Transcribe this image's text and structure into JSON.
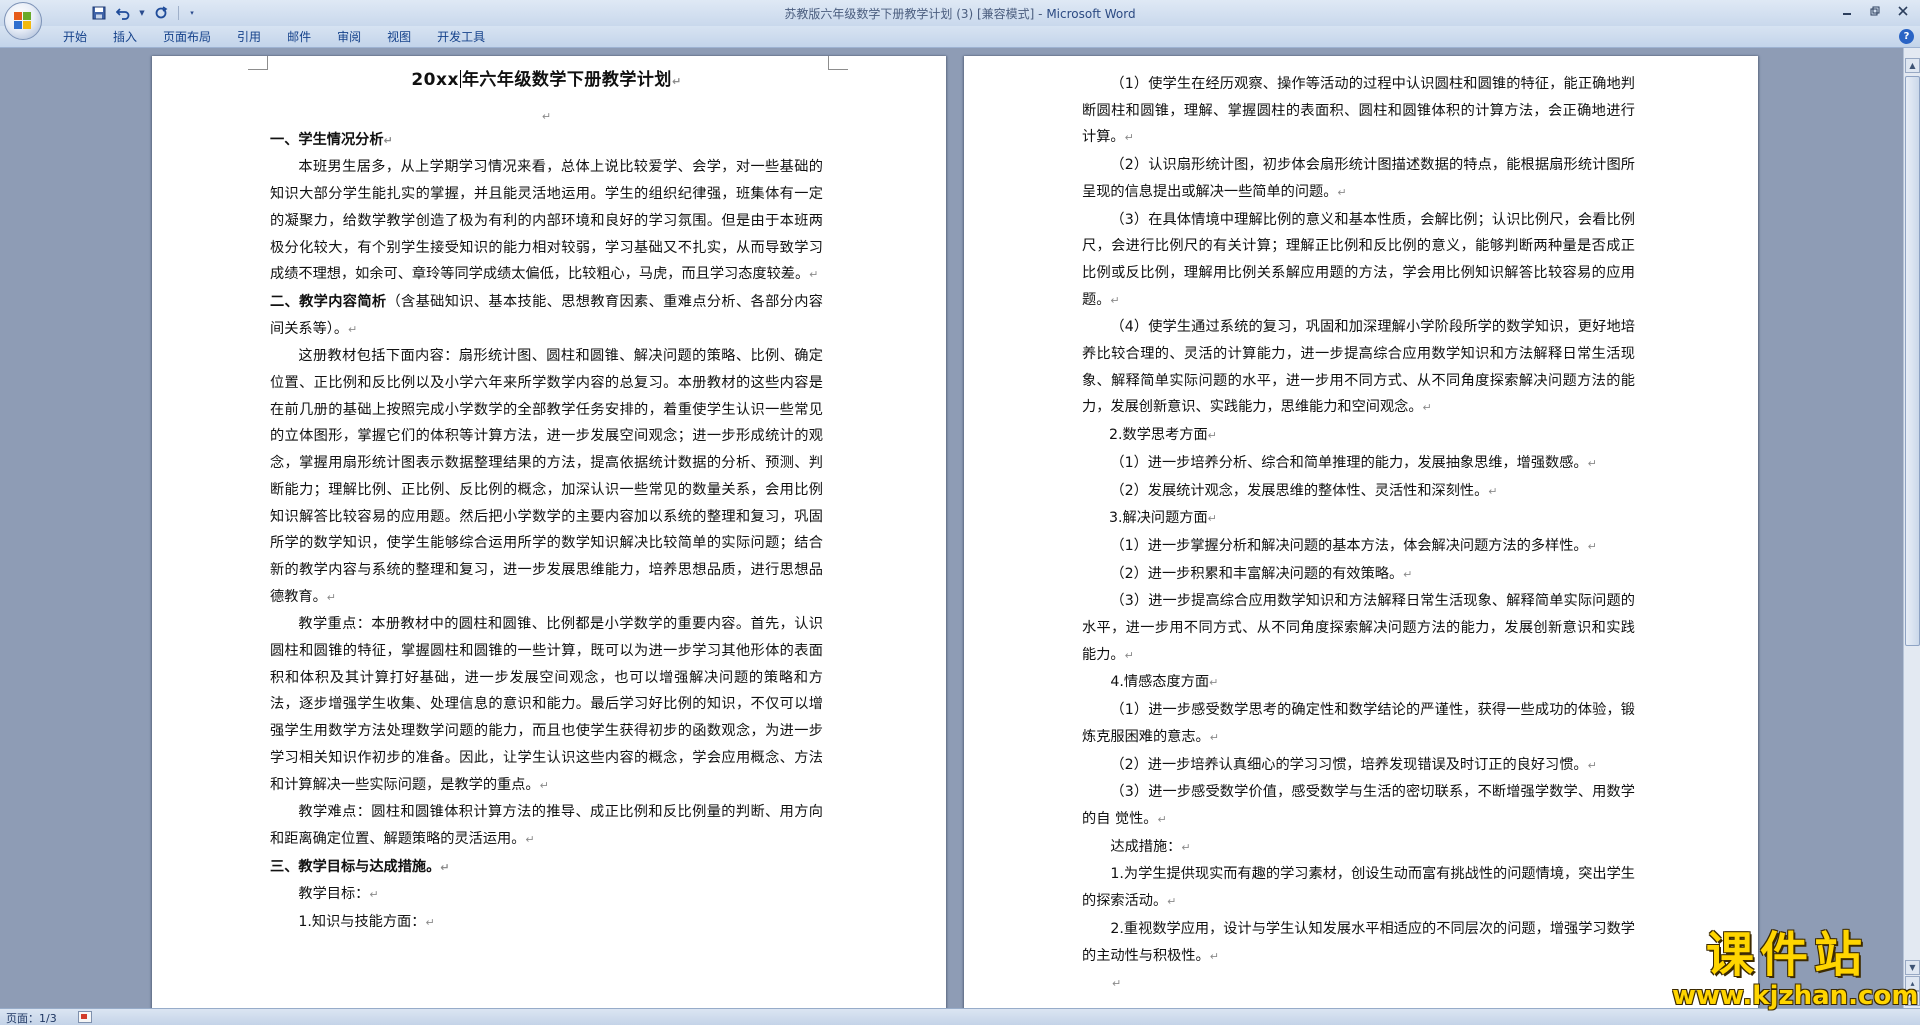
{
  "window": {
    "title": "苏教版六年级数学下册教学计划 (3) [兼容模式] - ",
    "app": "Microsoft Word"
  },
  "quick_access": {
    "save_icon": "save-icon",
    "undo_icon": "undo-icon",
    "redo_icon": "redo-icon",
    "customize_icon": "dropdown-icon"
  },
  "ribbon": {
    "tabs": [
      "开始",
      "插入",
      "页面布局",
      "引用",
      "邮件",
      "审阅",
      "视图",
      "开发工具"
    ],
    "help": "?"
  },
  "page1": {
    "title": "20xx年六年级数学下册教学计划",
    "paragraphs": [
      {
        "style": "h",
        "text": "一、学生情况分析"
      },
      {
        "style": "ind",
        "text": "本班男生居多，从上学期学习情况来看，总体上说比较爱学、会学，对一些基础的知识大部分学生能扎实的掌握，并且能灵活地运用。学生的组织纪律强，班集体有一定的凝聚力，给数学教学创造了极为有利的内部环境和良好的学习氛围。但是由于本班两极分化较大，有个别学生接受知识的能力相对较弱，学习基础又不扎实，从而导致学习成绩不理想，如余可、章玲等同学成绩太偏低，比较粗心，马虎，而且学习态度较差。"
      },
      {
        "style": "h-mixed",
        "bold": "二、教学内容简析",
        "text": "（含基础知识、基本技能、思想教育因素、重难点分析、各部分内容间关系等）。"
      },
      {
        "style": "ind",
        "text": "这册教材包括下面内容：扇形统计图、圆柱和圆锥、解决问题的策略、比例、确定位置、正比例和反比例以及小学六年来所学数学内容的总复习。本册教材的这些内容是在前几册的基础上按照完成小学数学的全部教学任务安排的，着重使学生认识一些常见的立体图形，掌握它们的体积等计算方法，进一步发展空间观念；进一步形成统计的观念，掌握用扇形统计图表示数据整理结果的方法，提高依据统计数据的分析、预测、判断能力；理解比例、正比例、反比例的概念，加深认识一些常见的数量关系，会用比例知识解答比较容易的应用题。然后把小学数学的主要内容加以系统的整理和复习，巩固所学的数学知识，使学生能够综合运用所学的数学知识解决比较简单的实际问题；结合新的教学内容与系统的整理和复习，进一步发展思维能力，培养思想品质，进行思想品德教育。"
      },
      {
        "style": "ind",
        "text": "教学重点：本册教材中的圆柱和圆锥、比例都是小学数学的重要内容。首先，认识圆柱和圆锥的特征，掌握圆柱和圆锥的一些计算，既可以为进一步学习其他形体的表面积和体积及其计算打好基础，进一步发展空间观念，也可以增强解决问题的策略和方法，逐步增强学生收集、处理信息的意识和能力。最后学习好比例的知识，不仅可以增强学生用数学方法处理数学问题的能力，而且也使学生获得初步的函数观念，为进一步学习相关知识作初步的准备。因此，让学生认识这些内容的概念，学会应用概念、方法和计算解决一些实际问题，是教学的重点。"
      },
      {
        "style": "ind",
        "text": "教学难点：圆柱和圆锥体积计算方法的推导、成正比例和反比例量的判断、用方向和距离确定位置、解题策略的灵活运用。"
      },
      {
        "style": "h",
        "text": "三、教学目标与达成措施。"
      },
      {
        "style": "ind",
        "text": "教学目标："
      },
      {
        "style": "ind",
        "text": "1.知识与技能方面："
      }
    ]
  },
  "page2": {
    "paragraphs": [
      {
        "style": "ind",
        "text": "（1）使学生在经历观察、操作等活动的过程中认识圆柱和圆锥的特征，能正确地判断圆柱和圆锥，理解、掌握圆柱的表面积、圆柱和圆锥体积的计算方法，会正确地进行计算。"
      },
      {
        "style": "ind",
        "text": "（2）认识扇形统计图，初步体会扇形统计图描述数据的特点，能根据扇形统计图所呈现的信息提出或解决一些简单的问题。"
      },
      {
        "style": "ind",
        "text": "（3）在具体情境中理解比例的意义和基本性质，会解比例；认识比例尺，会看比例尺，会进行比例尺的有关计算；理解正比例和反比例的意义，能够判断两种量是否成正比例或反比例，理解用比例关系解应用题的方法，学会用比例知识解答比较容易的应用题。"
      },
      {
        "style": "ind",
        "text": "（4）使学生通过系统的复习，巩固和加深理解小学阶段所学的数学知识，更好地培养比较合理的、灵活的计算能力，进一步提高综合应用数学知识和方法解释日常生活现象、解释简单实际问题的水平，进一步用不同方式、从不同角度探索解决问题方法的能力，发展创新意识、实践能力，思维能力和空间观念。"
      },
      {
        "style": "ind1",
        "text": "2.数学思考方面"
      },
      {
        "style": "ind",
        "text": "（1）进一步培养分析、综合和简单推理的能力，发展抽象思维，增强数感。"
      },
      {
        "style": "ind",
        "text": "（2）发展统计观念，发展思维的整体性、灵活性和深刻性。"
      },
      {
        "style": "ind1",
        "text": "3.解决问题方面"
      },
      {
        "style": "ind",
        "text": "（1）进一步掌握分析和解决问题的基本方法，体会解决问题方法的多样性。"
      },
      {
        "style": "ind",
        "text": "（2）进一步积累和丰富解决问题的有效策略。"
      },
      {
        "style": "ind",
        "text": "（3）进一步提高综合应用数学知识和方法解释日常生活现象、解释简单实际问题的水平，进一步用不同方式、从不同角度探索解决问题方法的能力，发展创新意识和实践能力。"
      },
      {
        "style": "ind",
        "text": "4.情感态度方面"
      },
      {
        "style": "ind",
        "text": "（1）进一步感受数学思考的确定性和数学结论的严谨性，获得一些成功的体验，锻炼克服困难的意志。"
      },
      {
        "style": "ind",
        "text": "（2）进一步培养认真细心的学习习惯，培养发现错误及时订正的良好习惯。"
      },
      {
        "style": "ind",
        "text": "（3）进一步感受数学价值，感受数学与生活的密切联系，不断增强学数学、用数学的自 觉性。"
      },
      {
        "style": "ind",
        "text": "达成措施："
      },
      {
        "style": "ind",
        "text": "1.为学生提供现实而有趣的学习素材，创设生动而富有挑战性的问题情境，突出学生的探索活动。"
      },
      {
        "style": "ind",
        "text": "2.重视数学应用，设计与学生认知发展水平相适应的不同层次的问题，增强学习数学的主动性与积极性。"
      }
    ]
  },
  "status": {
    "page": "页面：1/3"
  },
  "watermark": {
    "main": "课件站",
    "url": "www.kjzhan.com"
  },
  "colors": {
    "ribbon_text": "#15428b",
    "workspace": "#8e9cb5",
    "watermark": "#ffd500"
  }
}
